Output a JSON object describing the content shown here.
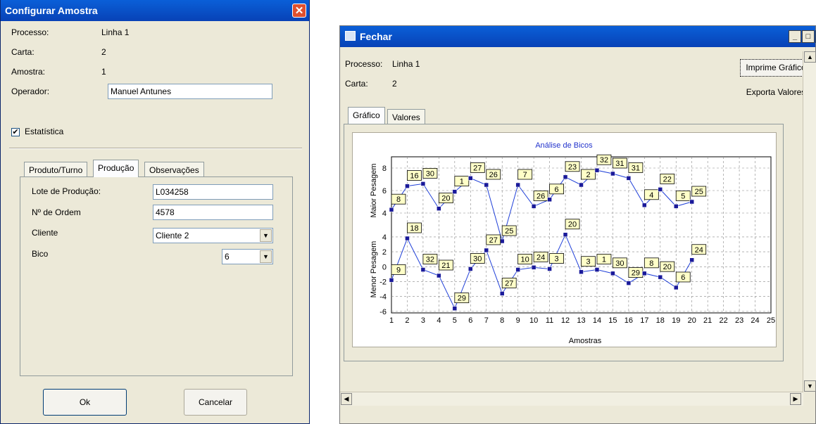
{
  "dialog1": {
    "title": "Configurar Amostra",
    "close_icon": "close-icon",
    "fields": [
      {
        "label": "Processo:",
        "value": "Linha 1"
      },
      {
        "label": "Carta:",
        "value": "2"
      },
      {
        "label": "Amostra:",
        "value": "1"
      }
    ],
    "operador_label": "Operador:",
    "operador_value": "Manuel Antunes",
    "estatistica_label": "Estatística",
    "estatistica_checked": "✔",
    "tabs": [
      "Produto/Turno",
      "Produção",
      "Observações"
    ],
    "active_tab": "Produção",
    "producao": {
      "lote_label": "Lote de Produção:",
      "lote_value": "L034258",
      "ordem_label": "Nº de Ordem",
      "ordem_value": "4578",
      "cliente_label": "Cliente",
      "cliente_value": "Cliente 2",
      "bico_label": "Bico",
      "bico_value": "6"
    },
    "ok_label": "Ok",
    "cancel_label": "Cancelar"
  },
  "dialog2": {
    "title": "Fechar",
    "processo_label": "Processo:",
    "processo_value": "Linha 1",
    "carta_label": "Carta:",
    "carta_value": "2",
    "print_button": "Imprime Gráfico",
    "export_button": "Exporta Valores",
    "tabs": [
      "Gráfico",
      "Valores"
    ],
    "active_tab": "Gráfico"
  },
  "chart_data": {
    "type": "line",
    "title": "Análise de Bicos",
    "xlabel": "Amostras",
    "x_ticks": [
      "1",
      "2",
      "3",
      "4",
      "5",
      "6",
      "7",
      "8",
      "9",
      "10",
      "11",
      "12",
      "13",
      "14",
      "15",
      "16",
      "17",
      "18",
      "19",
      "20",
      "21",
      "22",
      "23",
      "24",
      "25"
    ],
    "xlim": [
      1,
      25
    ],
    "grid": true,
    "panels": [
      {
        "ylabel": "Maior Pesagem",
        "ylim": [
          3,
          9
        ],
        "y_ticks": [
          4,
          6,
          8
        ],
        "x": [
          1,
          2,
          3,
          4,
          5,
          6,
          7,
          8,
          9,
          10,
          11,
          12,
          13,
          14,
          15,
          16,
          17,
          18,
          19,
          20
        ],
        "values": [
          4.3,
          6.4,
          6.6,
          4.4,
          5.9,
          7.1,
          6.5,
          1.5,
          6.5,
          4.6,
          5.2,
          7.2,
          6.5,
          7.8,
          7.5,
          7.1,
          4.7,
          6.1,
          4.6,
          5.0
        ],
        "point_labels": [
          "8",
          "16",
          "30",
          "20",
          "1",
          "27",
          "26",
          "25",
          "7",
          "26",
          "6",
          "23",
          "2",
          "32",
          "31",
          "31",
          "4",
          "22",
          "5",
          "25"
        ]
      },
      {
        "ylabel": "Menor Pesagem",
        "ylim": [
          -6,
          2
        ],
        "y_ticks": [
          -6,
          -4,
          -2,
          0,
          2,
          4
        ],
        "x": [
          1,
          2,
          3,
          4,
          5,
          6,
          7,
          8,
          9,
          10,
          11,
          12,
          13,
          14,
          15,
          16,
          17,
          18,
          19,
          20
        ],
        "values": [
          -1.8,
          3.8,
          -0.4,
          -1.2,
          -5.6,
          -0.3,
          2.2,
          -3.6,
          -0.4,
          -0.1,
          -0.3,
          4.3,
          -0.7,
          -0.4,
          -0.9,
          -2.2,
          -0.9,
          -1.4,
          -2.8,
          0.9
        ],
        "point_labels": [
          "9",
          "18",
          "32",
          "21",
          "29",
          "30",
          "27",
          "27",
          "10",
          "24",
          "3",
          "20",
          "3",
          "1",
          "30",
          "29",
          "8",
          "20",
          "6",
          "24"
        ]
      }
    ],
    "series_color": "#1f3fd8",
    "marker_color": "#1a1a9a"
  }
}
